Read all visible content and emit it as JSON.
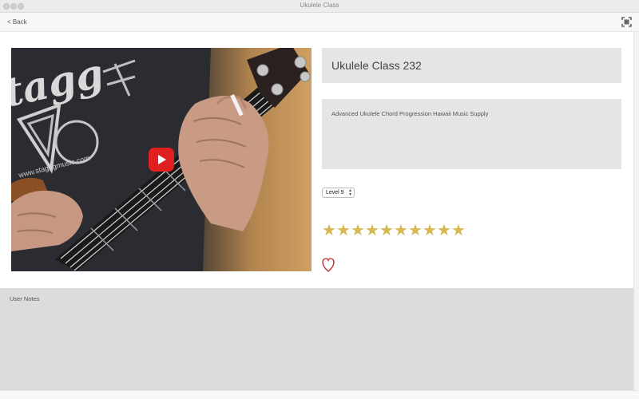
{
  "window": {
    "title": "Ukulele Class"
  },
  "toolbar": {
    "back_label": "< Back",
    "fullscreen_icon": "fullscreen-icon"
  },
  "lesson": {
    "title": "Ukulele Class 232",
    "description": "Advanced Ukulele Chord Progression Hawaii Music Supply",
    "level": "Level 9",
    "rating": 10,
    "rating_max": 10,
    "favorited": false
  },
  "video": {
    "play_icon": "play-icon",
    "thumbnail_print": "www.stagggmusic.com"
  },
  "notes": {
    "label": "User Notes",
    "value": ""
  },
  "colors": {
    "star": "#d7b751",
    "heart": "#c0262b",
    "play": "#e02020",
    "panel": "#e5e5e5",
    "notes_bg": "#dcdcdc"
  }
}
